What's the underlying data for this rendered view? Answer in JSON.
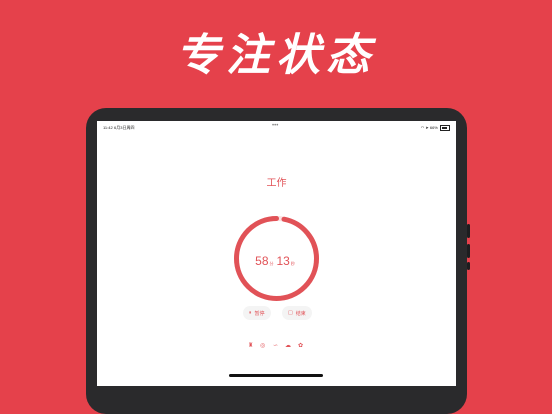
{
  "headline": "专注状态",
  "status_bar": {
    "time": "11:42",
    "date": "6月3日周四",
    "dots": "•••",
    "battery": "66%"
  },
  "focus": {
    "mode_label": "工作",
    "minutes": "58",
    "minutes_unit": "分",
    "seconds": "13",
    "seconds_unit": "秒",
    "progress_remaining": 0.97
  },
  "controls": {
    "pause_label": "暂停",
    "end_label": "结束"
  },
  "toolbar": [
    "tomato-icon",
    "sound-icon",
    "wave-icon",
    "cloud-icon",
    "flower-icon"
  ],
  "colors": {
    "background": "#e5414b",
    "accent": "#e15257",
    "ring_track": "#fbe1e2"
  }
}
